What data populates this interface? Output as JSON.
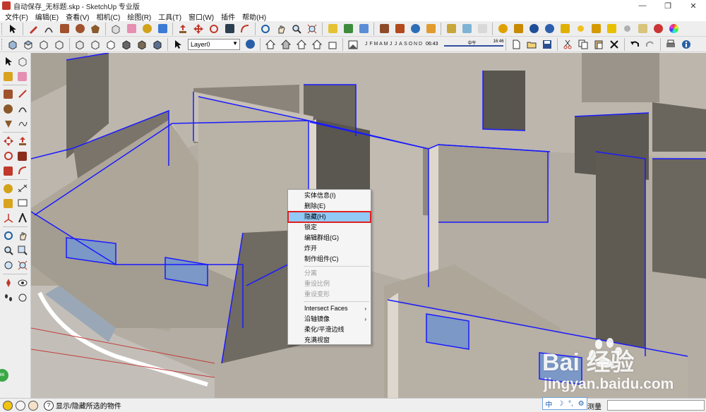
{
  "window": {
    "title": "自动保存_无标题.skp - SketchUp 专业版",
    "minimize_glyph": "—",
    "maximize_glyph": "❐",
    "close_glyph": "✕"
  },
  "menus": [
    "文件(F)",
    "编辑(E)",
    "查看(V)",
    "相机(C)",
    "绘图(R)",
    "工具(T)",
    "窗口(W)",
    "插件",
    "帮助(H)"
  ],
  "layer_selector": {
    "value": "Layer0",
    "arrow": "▼"
  },
  "shadow_settings": {
    "months": [
      "J",
      "F",
      "M",
      "A",
      "M",
      "J",
      "J",
      "A",
      "S",
      "O",
      "N",
      "D"
    ],
    "time_start": "06:43",
    "time_noon": "中午",
    "time_end": "16:46"
  },
  "context_menu": {
    "items": [
      {
        "label": "实体信息(I)",
        "enabled": true
      },
      {
        "label": "删除(E)",
        "enabled": true
      },
      {
        "label": "隐藏(H)",
        "enabled": true,
        "highlighted": true
      },
      {
        "label": "锁定",
        "enabled": true
      },
      {
        "label": "编辑群组(G)",
        "enabled": true
      },
      {
        "label": "炸开",
        "enabled": true
      },
      {
        "label": "制作组件(C)",
        "enabled": true,
        "separator_after": true
      },
      {
        "label": "分离",
        "enabled": false
      },
      {
        "label": "重设比例",
        "enabled": false
      },
      {
        "label": "重设变形",
        "enabled": false,
        "separator_after": true
      },
      {
        "label": "Intersect Faces",
        "enabled": true,
        "submenu": true
      },
      {
        "label": "沿轴镜像",
        "enabled": true,
        "submenu": true
      },
      {
        "label": "柔化/平滑边线",
        "enabled": true
      },
      {
        "label": "充满视窗",
        "enabled": true
      }
    ],
    "submenu_arrow": "›"
  },
  "statusbar": {
    "help_glyph": "?",
    "text": "显示/隐藏所选的物件",
    "measure_label": "测量",
    "measure_value": ""
  },
  "ime": {
    "items": [
      "中",
      "☽",
      "°,",
      "⚙"
    ]
  },
  "watermark": {
    "logo": "Bai  经验",
    "url": "jingyan.baidu.com"
  },
  "badge": {
    "text": "66"
  },
  "colors": {
    "selection_blue": "#1a1aff",
    "highlight_outline": "#e02020",
    "highlight_fill": "#91c9f7",
    "wall_top": "#c9c3ba",
    "wall_face": "#a7a196",
    "floor": "#b5ada2"
  }
}
